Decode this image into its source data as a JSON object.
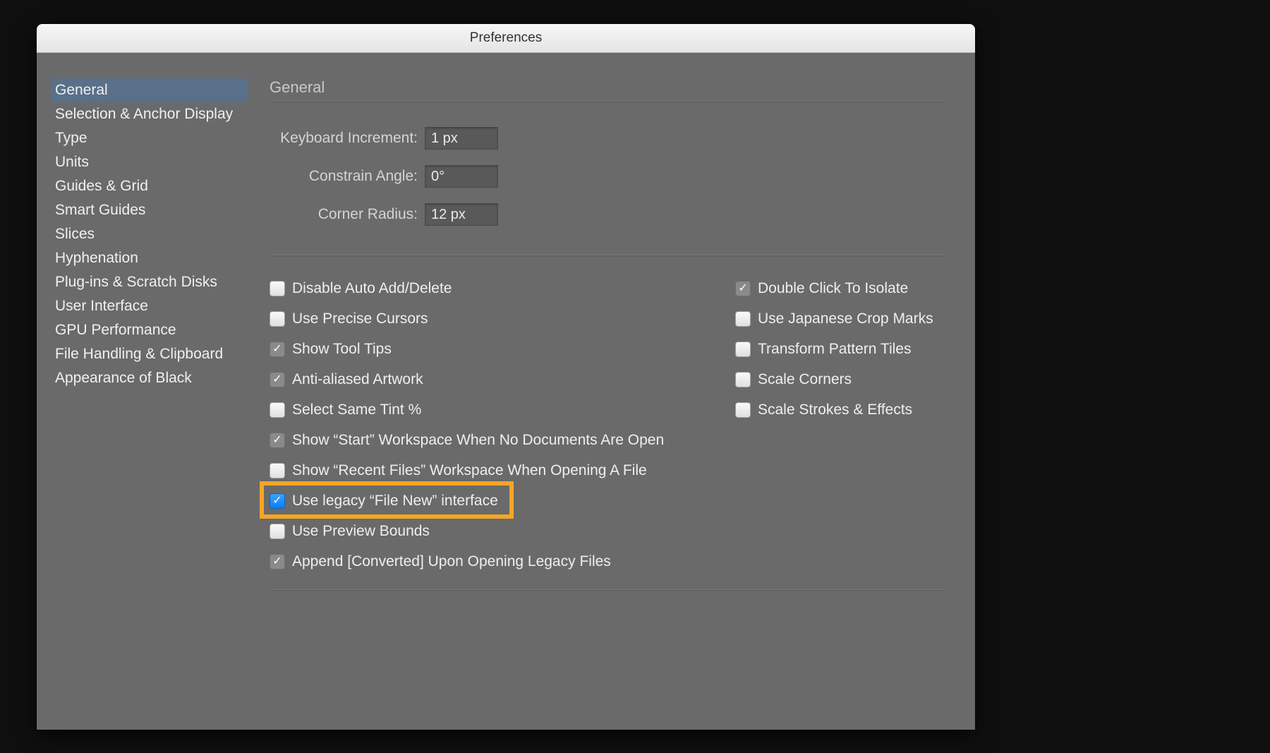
{
  "window": {
    "title": "Preferences"
  },
  "sidebar": {
    "items": [
      {
        "label": "General",
        "selected": true
      },
      {
        "label": "Selection & Anchor Display",
        "selected": false
      },
      {
        "label": "Type",
        "selected": false
      },
      {
        "label": "Units",
        "selected": false
      },
      {
        "label": "Guides & Grid",
        "selected": false
      },
      {
        "label": "Smart Guides",
        "selected": false
      },
      {
        "label": "Slices",
        "selected": false
      },
      {
        "label": "Hyphenation",
        "selected": false
      },
      {
        "label": "Plug-ins & Scratch Disks",
        "selected": false
      },
      {
        "label": "User Interface",
        "selected": false
      },
      {
        "label": "GPU Performance",
        "selected": false
      },
      {
        "label": "File Handling & Clipboard",
        "selected": false
      },
      {
        "label": "Appearance of Black",
        "selected": false
      }
    ]
  },
  "panel": {
    "title": "General",
    "fields": {
      "keyboard_increment": {
        "label": "Keyboard Increment:",
        "value": "1 px"
      },
      "constrain_angle": {
        "label": "Constrain Angle:",
        "value": "0°"
      },
      "corner_radius": {
        "label": "Corner Radius:",
        "value": "12 px"
      }
    },
    "checks_left": [
      {
        "label": "Disable Auto Add/Delete",
        "state": "unchecked"
      },
      {
        "label": "Use Precise Cursors",
        "state": "unchecked"
      },
      {
        "label": "Show Tool Tips",
        "state": "gray"
      },
      {
        "label": "Anti-aliased Artwork",
        "state": "gray"
      },
      {
        "label": "Select Same Tint %",
        "state": "unchecked"
      },
      {
        "label": "Show “Start” Workspace When No Documents Are Open",
        "state": "gray"
      },
      {
        "label": "Show “Recent Files” Workspace When Opening A File",
        "state": "unchecked"
      },
      {
        "label": "Use legacy “File New” interface",
        "state": "blue",
        "highlight": true
      },
      {
        "label": "Use Preview Bounds",
        "state": "unchecked"
      },
      {
        "label": "Append [Converted] Upon Opening Legacy Files",
        "state": "gray"
      }
    ],
    "checks_right": [
      {
        "label": "Double Click To Isolate",
        "state": "gray"
      },
      {
        "label": "Use Japanese Crop Marks",
        "state": "unchecked"
      },
      {
        "label": "Transform Pattern Tiles",
        "state": "unchecked"
      },
      {
        "label": "Scale Corners",
        "state": "unchecked"
      },
      {
        "label": "Scale Strokes & Effects",
        "state": "unchecked"
      }
    ]
  },
  "glyphs": {
    "check": "✓"
  }
}
